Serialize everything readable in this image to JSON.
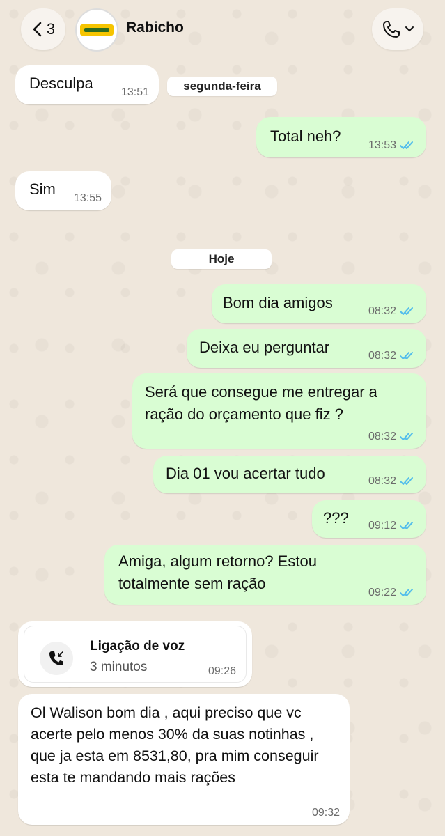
{
  "header": {
    "back_count": "3",
    "contact_name": "Rabicho",
    "avatar_icon": "rabicho-logo"
  },
  "days": {
    "segunda": "segunda-feira",
    "hoje": "Hoje"
  },
  "messages": [
    {
      "text": "Desculpa",
      "time": "13:51",
      "direction": "in"
    },
    {
      "text": "Total neh?",
      "time": "13:53",
      "direction": "out"
    },
    {
      "text": "Sim",
      "time": "13:55",
      "direction": "in"
    },
    {
      "text": "Bom dia amigos",
      "time": "08:32",
      "direction": "out"
    },
    {
      "text": "Deixa eu perguntar",
      "time": "08:32",
      "direction": "out"
    },
    {
      "text": "Será que consegue me entregar a ração do orçamento que fiz ?",
      "time": "08:32",
      "direction": "out"
    },
    {
      "text": "Dia 01 vou acertar tudo",
      "time": "08:32",
      "direction": "out"
    },
    {
      "text": "???",
      "time": "09:12",
      "direction": "out"
    },
    {
      "text": "Amiga, algum retorno? Estou totalmente sem ração",
      "time": "09:22",
      "direction": "out"
    },
    {
      "text": "Ol Walison bom dia , aqui preciso que vc acerte pelo menos 30%  da suas notinhas , que ja esta em  8531,80, pra mim conseguir esta te mandando mais rações",
      "time": "09:32",
      "direction": "in"
    }
  ],
  "call": {
    "title": "Ligação de voz",
    "duration": "3 minutos",
    "time": "09:26"
  },
  "colors": {
    "outgoing": "#d9fdd3",
    "incoming": "#ffffff",
    "read_ticks": "#53bdeb",
    "wallpaper": "#efe7dc"
  }
}
